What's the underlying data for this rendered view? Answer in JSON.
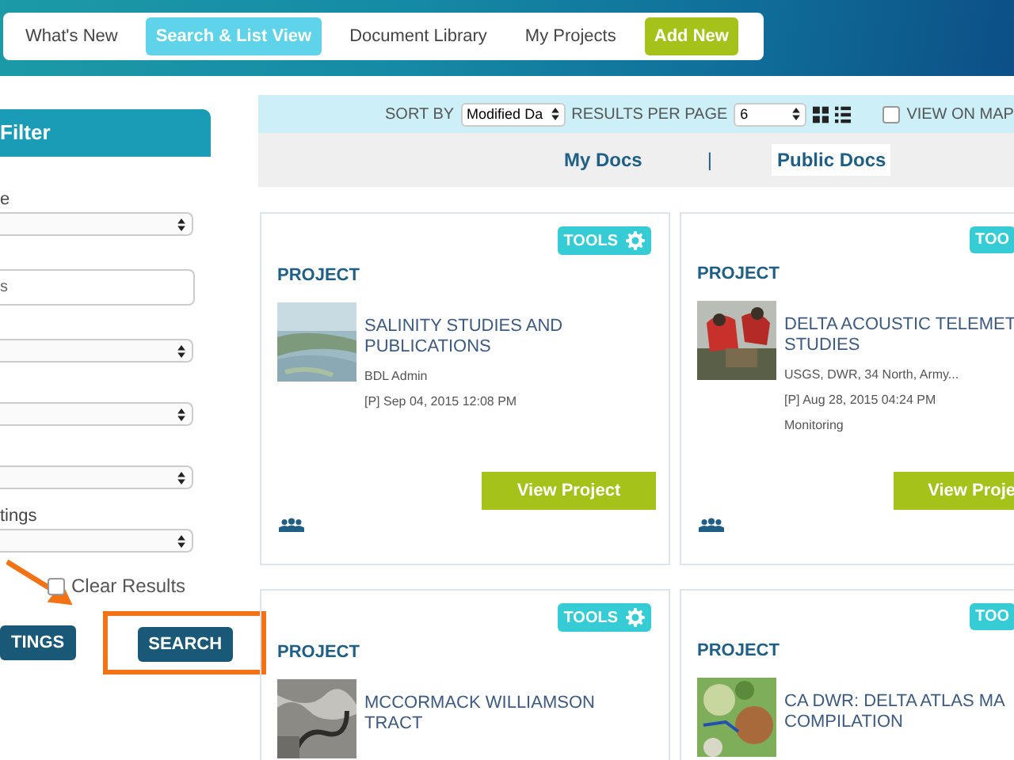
{
  "nav": {
    "items": [
      {
        "label": "What's New",
        "kind": "link",
        "selected": false
      },
      {
        "label": "Search & List View",
        "kind": "link",
        "selected": true
      },
      {
        "label": "Document Library",
        "kind": "link",
        "selected": false
      },
      {
        "label": "My Projects",
        "kind": "link",
        "selected": false
      },
      {
        "label": "Add New",
        "kind": "action",
        "selected": false
      }
    ]
  },
  "sidebar": {
    "title": "Filter",
    "fields": [
      {
        "kind": "select",
        "label": "e"
      },
      {
        "kind": "input",
        "value": "s"
      },
      {
        "kind": "select"
      },
      {
        "kind": "select"
      },
      {
        "kind": "select"
      },
      {
        "kind": "select",
        "label": "tings"
      }
    ],
    "clear_results": {
      "label": "Clear Results",
      "checked": false
    },
    "buttons": [
      "TINGS",
      "SEARCH"
    ]
  },
  "toolbar": {
    "sort_label": "SORT BY",
    "sort_value": "Modified Da",
    "per_page_label": "RESULTS PER PAGE",
    "per_page_value": "6",
    "view_on_map": {
      "label": "VIEW ON MAP",
      "checked": false
    }
  },
  "doc_tabs": [
    {
      "label": "My Docs",
      "selected": false
    },
    {
      "label": "Public Docs",
      "selected": true
    }
  ],
  "doc_tab_separator": "|",
  "cards": [
    {
      "tools": "TOOLS",
      "type": "PROJECT",
      "title": "SALINITY STUDIES AND PUBLICATIONS",
      "meta": [
        "BDL Admin",
        "[P] Sep 04, 2015 12:08 PM"
      ],
      "button": "View Project"
    },
    {
      "tools": "TOO",
      "type": "PROJECT",
      "title": "DELTA ACOUSTIC TELEMET STUDIES",
      "meta": [
        "USGS, DWR, 34 North, Army...",
        "[P] Aug 28, 2015 04:24 PM",
        "Monitoring"
      ],
      "button": "View Proje"
    },
    {
      "tools": "TOOLS",
      "type": "PROJECT",
      "title": "MCCORMACK WILLIAMSON TRACT"
    },
    {
      "tools": "TOO",
      "type": "PROJECT",
      "title": "CA DWR: DELTA ATLAS MA COMPILATION"
    }
  ]
}
